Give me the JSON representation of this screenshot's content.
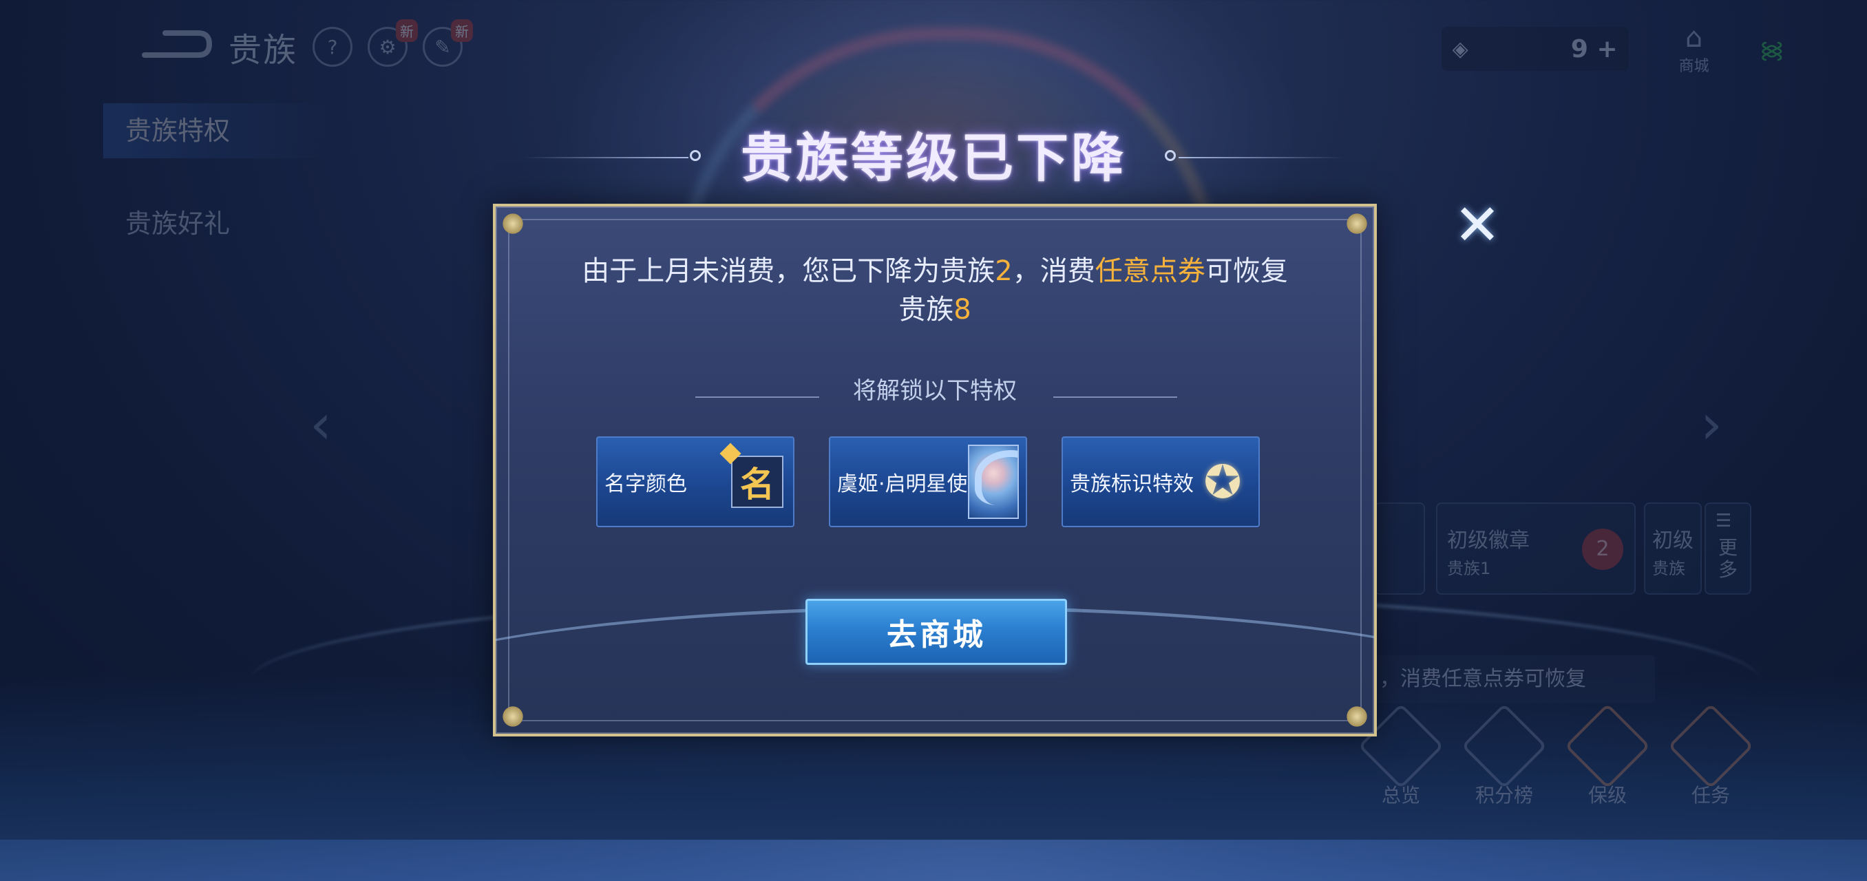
{
  "header": {
    "page_title": "贵族",
    "help_icon": "?",
    "badge_new_1": "新",
    "badge_new_2": "新",
    "currency_value": "9",
    "currency_add": "+",
    "shop_label": "商城"
  },
  "sidebar": {
    "items": [
      {
        "label": "贵族特权"
      },
      {
        "label": "贵族好礼"
      }
    ]
  },
  "background": {
    "badge_card_title": "初级徽章",
    "badge_card_sub": "贵族1",
    "badge_level": "2",
    "card2_title": "初级",
    "card2_sub": "贵族",
    "more_label": "更多",
    "tip_strip": "，消费任意点券可恢复",
    "bottom_nav": [
      {
        "label": "总览"
      },
      {
        "label": "积分榜"
      },
      {
        "label": "保级"
      },
      {
        "label": "任务"
      }
    ]
  },
  "modal": {
    "title": "贵族等级已下降",
    "msg_part1": "由于上月未消费，您已下降为贵族",
    "msg_level_now": "2",
    "msg_part2": "，消费",
    "msg_highlight": "任意点券",
    "msg_part3": "可恢复",
    "msg_part4": "贵族",
    "msg_level_restore": "8",
    "unlock_title": "将解锁以下特权",
    "perks": [
      {
        "label": "名字颜色",
        "icon_text": "名"
      },
      {
        "label": "虞姬·启明星使"
      },
      {
        "label": "贵族标识特效"
      }
    ],
    "go_button": "去商城",
    "close_icon": "✕"
  },
  "colors": {
    "highlight": "#f6b23b",
    "button_blue": "#2b7fd0",
    "frame_gold": "#d3c28d"
  }
}
